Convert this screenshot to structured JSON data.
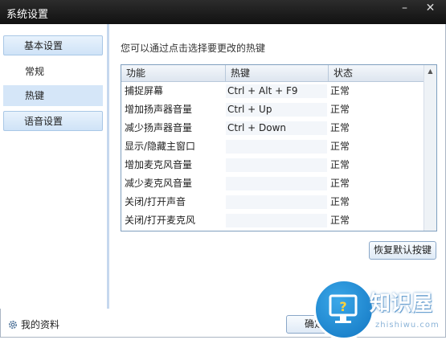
{
  "window": {
    "title": "系统设置",
    "minimize_label": "–",
    "close_label": "✕"
  },
  "sidebar": {
    "sections": [
      {
        "label": "基本设置"
      },
      {
        "label": "语音设置"
      }
    ],
    "items": [
      {
        "label": "常规"
      },
      {
        "label": "热键"
      }
    ],
    "profile_label": "我的资料"
  },
  "main": {
    "hint": "您可以通过点击选择要更改的热键",
    "table": {
      "columns": [
        "功能",
        "热键",
        "状态"
      ],
      "rows": [
        {
          "function": "捕捉屏幕",
          "hotkey": "Ctrl + Alt + F9",
          "status": "正常"
        },
        {
          "function": "增加扬声器音量",
          "hotkey": "Ctrl + Up",
          "status": "正常"
        },
        {
          "function": "减少扬声器音量",
          "hotkey": "Ctrl + Down",
          "status": "正常"
        },
        {
          "function": "显示/隐藏主窗口",
          "hotkey": "",
          "status": "正常"
        },
        {
          "function": "增加麦克风音量",
          "hotkey": "",
          "status": "正常"
        },
        {
          "function": "减少麦克风音量",
          "hotkey": "",
          "status": "正常"
        },
        {
          "function": "关闭/打开声音",
          "hotkey": "",
          "status": "正常"
        },
        {
          "function": "关闭/打开麦克风",
          "hotkey": "",
          "status": "正常"
        }
      ]
    },
    "restore_button": "恢复默认按键",
    "ok_button": "确定"
  },
  "watermark": {
    "title": "知识屋",
    "url": "zhishiwu.com"
  },
  "colors": {
    "accent": "#1276c2",
    "selection": "#d5e6f8"
  }
}
